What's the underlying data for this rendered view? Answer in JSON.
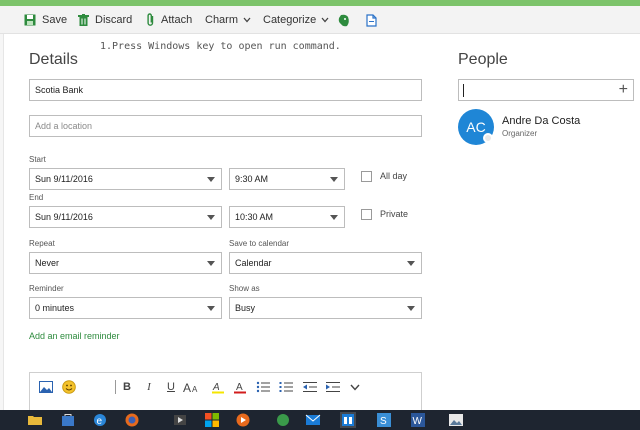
{
  "toolbar": {
    "save_label": "Save",
    "discard_label": "Discard",
    "attach_label": "Attach",
    "charm_label": "Charm",
    "categorize_label": "Categorize"
  },
  "details": {
    "heading": "Details",
    "title_value": "Scotia Bank",
    "location_placeholder": "Add a location",
    "start_label": "Start",
    "start_date": "Sun 9/11/2016",
    "start_time": "9:30 AM",
    "all_day_label": "All day",
    "end_label": "End",
    "end_date": "Sun 9/11/2016",
    "end_time": "10:30 AM",
    "private_label": "Private",
    "repeat_label": "Repeat",
    "repeat_value": "Never",
    "save_to_calendar_label": "Save to calendar",
    "calendar_value": "Calendar",
    "reminder_label": "Reminder",
    "reminder_value": "0 minutes",
    "show_as_label": "Show as",
    "show_as_value": "Busy",
    "email_reminder_link": "Add an email reminder"
  },
  "people": {
    "heading": "People",
    "attendee": {
      "initials": "AC",
      "name": "Andre Da Costa",
      "role": "Organizer"
    }
  },
  "editor": {
    "bold": "B",
    "italic": "I",
    "underline": "U",
    "background_text": "1.Press Windows   key to open run command."
  },
  "colors": {
    "accent_green": "#2e8b3e",
    "avatar_blue": "#1f86d6",
    "taskbar": "#1e2530"
  }
}
